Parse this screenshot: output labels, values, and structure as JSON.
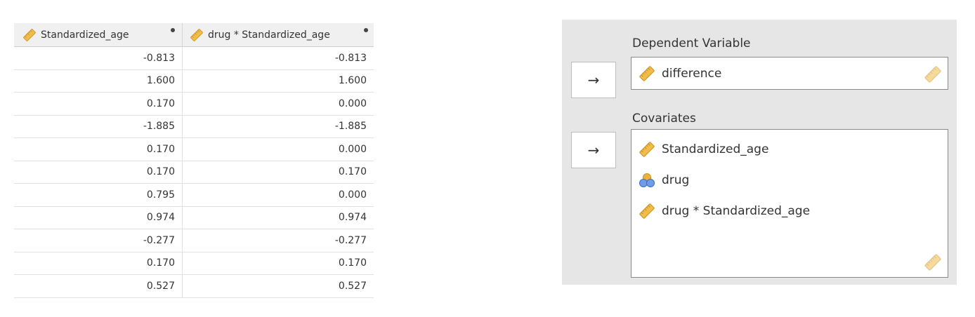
{
  "table": {
    "columns": [
      {
        "name": "Standardized_age",
        "icon": "ruler-icon"
      },
      {
        "name": "drug * Standardized_age",
        "icon": "ruler-icon"
      }
    ],
    "rows": [
      [
        "-0.813",
        "-0.813"
      ],
      [
        "1.600",
        "1.600"
      ],
      [
        "0.170",
        "0.000"
      ],
      [
        "-1.885",
        "-1.885"
      ],
      [
        "0.170",
        "0.000"
      ],
      [
        "0.170",
        "0.170"
      ],
      [
        "0.795",
        "0.000"
      ],
      [
        "0.974",
        "0.974"
      ],
      [
        "-0.277",
        "-0.277"
      ],
      [
        "0.170",
        "0.170"
      ],
      [
        "0.527",
        "0.527"
      ]
    ]
  },
  "panel": {
    "dependent_label": "Dependent Variable",
    "dependent_value": "difference",
    "covariates_label": "Covariates",
    "covariates": [
      {
        "name": "Standardized_age",
        "icon": "ruler-icon"
      },
      {
        "name": "drug",
        "icon": "nominal-icon"
      },
      {
        "name": "drug * Standardized_age",
        "icon": "ruler-icon"
      }
    ],
    "arrow": "→"
  },
  "colors": {
    "ruler": "#e8b23a",
    "nominal_blue": "#4a7fd4",
    "nominal_orange": "#e8a23a"
  }
}
